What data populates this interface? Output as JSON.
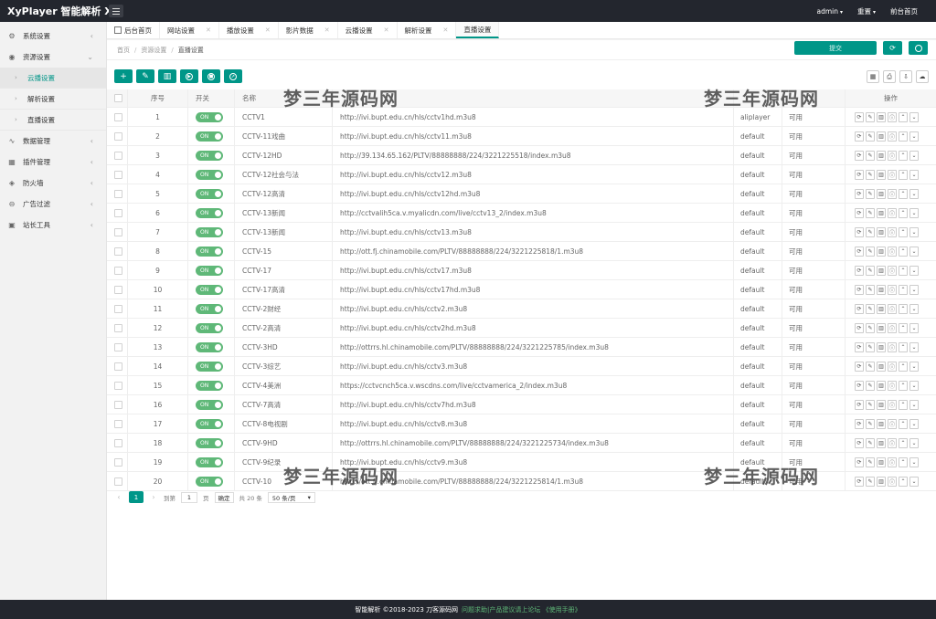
{
  "app": {
    "brand": "XyPlayer 智能解析 X4"
  },
  "header": {
    "user": "admin",
    "reset": "重置",
    "frontend": "前台首页"
  },
  "sidebar": {
    "items": [
      {
        "label": "系统设置",
        "icon": "gear-icon",
        "glyph": "⚙",
        "arrow": "‹"
      },
      {
        "label": "资源设置",
        "icon": "rss-icon",
        "glyph": "◉",
        "arrow": "⌄"
      },
      {
        "label": "数据管理",
        "icon": "pulse-icon",
        "glyph": "∿",
        "arrow": "‹"
      },
      {
        "label": "插件管理",
        "icon": "plugin-icon",
        "glyph": "▦",
        "arrow": "‹"
      },
      {
        "label": "防火墙",
        "icon": "shield-icon",
        "glyph": "◈",
        "arrow": "‹"
      },
      {
        "label": "广告过滤",
        "icon": "filter-icon",
        "glyph": "⊖",
        "arrow": "‹"
      },
      {
        "label": "站长工具",
        "icon": "tools-icon",
        "glyph": "▣",
        "arrow": "‹"
      }
    ],
    "subitems": [
      {
        "label": "云播设置",
        "active": true
      },
      {
        "label": "解析设置",
        "active": false
      },
      {
        "label": "直播设置",
        "active": false
      }
    ]
  },
  "tabs": [
    {
      "label": "后台首页",
      "closable": false
    },
    {
      "label": "网站设置",
      "closable": true
    },
    {
      "label": "播放设置",
      "closable": true
    },
    {
      "label": "影片数据",
      "closable": true
    },
    {
      "label": "云播设置",
      "closable": true
    },
    {
      "label": "解析设置",
      "closable": true
    },
    {
      "label": "直播设置",
      "closable": false,
      "active": true
    }
  ],
  "breadcrumb": {
    "home": "首页",
    "section": "资源设置",
    "current": "直播设置"
  },
  "top_action": {
    "save_label": "提交"
  },
  "table": {
    "headers": {
      "no": "序号",
      "switch": "开关",
      "name": "名称",
      "url": "",
      "player": "",
      "status": "",
      "ops": "操作"
    },
    "switch_label": "ON",
    "rows": [
      {
        "no": "1",
        "name": "CCTV1",
        "url": "http://ivi.bupt.edu.cn/hls/cctv1hd.m3u8",
        "player": "aliplayer",
        "status": "可用"
      },
      {
        "no": "2",
        "name": "CCTV-11戏曲",
        "url": "http://ivi.bupt.edu.cn/hls/cctv11.m3u8",
        "player": "default",
        "status": "可用"
      },
      {
        "no": "3",
        "name": "CCTV-12HD",
        "url": "http://39.134.65.162/PLTV/88888888/224/3221225518/index.m3u8",
        "player": "default",
        "status": "可用"
      },
      {
        "no": "4",
        "name": "CCTV-12社会与法",
        "url": "http://ivi.bupt.edu.cn/hls/cctv12.m3u8",
        "player": "default",
        "status": "可用"
      },
      {
        "no": "5",
        "name": "CCTV-12高清",
        "url": "http://ivi.bupt.edu.cn/hls/cctv12hd.m3u8",
        "player": "default",
        "status": "可用"
      },
      {
        "no": "6",
        "name": "CCTV-13新闻",
        "url": "http://cctvalih5ca.v.myalicdn.com/live/cctv13_2/index.m3u8",
        "player": "default",
        "status": "可用"
      },
      {
        "no": "7",
        "name": "CCTV-13新闻",
        "url": "http://ivi.bupt.edu.cn/hls/cctv13.m3u8",
        "player": "default",
        "status": "可用"
      },
      {
        "no": "8",
        "name": "CCTV-15",
        "url": "http://ott.fj.chinamobile.com/PLTV/88888888/224/3221225818/1.m3u8",
        "player": "default",
        "status": "可用"
      },
      {
        "no": "9",
        "name": "CCTV-17",
        "url": "http://ivi.bupt.edu.cn/hls/cctv17.m3u8",
        "player": "default",
        "status": "可用"
      },
      {
        "no": "10",
        "name": "CCTV-17高清",
        "url": "http://ivi.bupt.edu.cn/hls/cctv17hd.m3u8",
        "player": "default",
        "status": "可用"
      },
      {
        "no": "11",
        "name": "CCTV-2财经",
        "url": "http://ivi.bupt.edu.cn/hls/cctv2.m3u8",
        "player": "default",
        "status": "可用"
      },
      {
        "no": "12",
        "name": "CCTV-2高清",
        "url": "http://ivi.bupt.edu.cn/hls/cctv2hd.m3u8",
        "player": "default",
        "status": "可用"
      },
      {
        "no": "13",
        "name": "CCTV-3HD",
        "url": "http://ottrrs.hl.chinamobile.com/PLTV/88888888/224/3221225785/index.m3u8",
        "player": "default",
        "status": "可用"
      },
      {
        "no": "14",
        "name": "CCTV-3综艺",
        "url": "http://ivi.bupt.edu.cn/hls/cctv3.m3u8",
        "player": "default",
        "status": "可用"
      },
      {
        "no": "15",
        "name": "CCTV-4美洲",
        "url": "https://cctvcnch5ca.v.wscdns.com/live/cctvamerica_2/index.m3u8",
        "player": "default",
        "status": "可用"
      },
      {
        "no": "16",
        "name": "CCTV-7高清",
        "url": "http://ivi.bupt.edu.cn/hls/cctv7hd.m3u8",
        "player": "default",
        "status": "可用"
      },
      {
        "no": "17",
        "name": "CCTV-8电视剧",
        "url": "http://ivi.bupt.edu.cn/hls/cctv8.m3u8",
        "player": "default",
        "status": "可用"
      },
      {
        "no": "18",
        "name": "CCTV-9HD",
        "url": "http://ottrrs.hl.chinamobile.com/PLTV/88888888/224/3221225734/index.m3u8",
        "player": "default",
        "status": "可用"
      },
      {
        "no": "19",
        "name": "CCTV-9纪录",
        "url": "http://ivi.bupt.edu.cn/hls/cctv9.m3u8",
        "player": "default",
        "status": "可用"
      },
      {
        "no": "20",
        "name": "CCTV-10",
        "url": "http://ott.fj.chinamobile.com/PLTV/88888888/224/3221225814/1.m3u8",
        "player": "default",
        "status": "可用"
      }
    ]
  },
  "pager": {
    "current": "1",
    "goto_label": "到第",
    "page_input": "1",
    "page_unit": "页",
    "confirm": "确定",
    "total": "共 20 条",
    "per_page": "50 条/页"
  },
  "watermark": "梦三年源码网",
  "footer": {
    "text": "智能解析 ©2018-2023 刀客源码网",
    "link": "问题求助|产品建议请上论坛 《使用手册》"
  },
  "colors": {
    "accent": "#009688",
    "switch_on": "#5fb878",
    "topbar": "#23262e"
  }
}
